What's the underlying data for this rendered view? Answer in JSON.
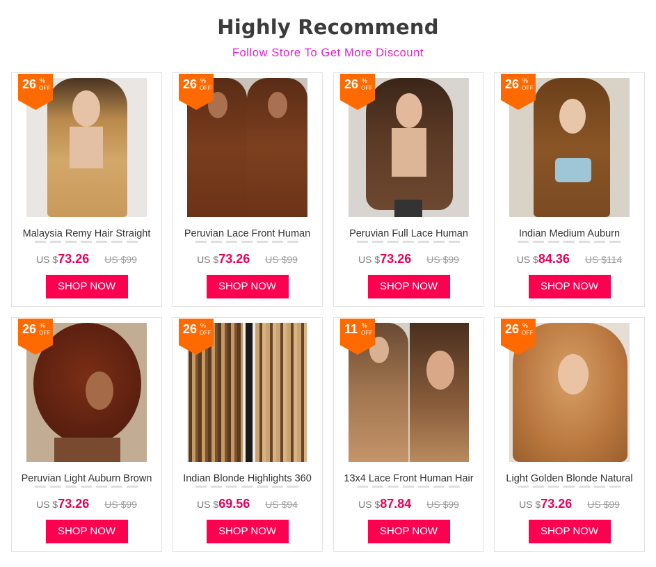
{
  "header": {
    "title": "Highly Recommend",
    "subtitle": "Follow Store To Get More Discount"
  },
  "colors": {
    "badge": "#ff6a00",
    "button": "#ff0051",
    "price": "#e8005a",
    "subtitle": "#e81fd0"
  },
  "badge_suffix": {
    "pct": "%",
    "off": "OFF"
  },
  "button_label": "SHOP NOW",
  "currency": "US $",
  "products": [
    {
      "name": "Malaysia Remy Hair Straight",
      "discount": "26",
      "price": "73.26",
      "old_price": "US $99",
      "image": "honey-blonde-straight-wig"
    },
    {
      "name": "Peruvian Lace Front Human",
      "discount": "26",
      "price": "73.26",
      "old_price": "US $99",
      "image": "brown-body-wave-wig-pair"
    },
    {
      "name": "Peruvian Full Lace Human",
      "discount": "26",
      "price": "73.26",
      "old_price": "US $99",
      "image": "brown-body-wave-wig-mannequin"
    },
    {
      "name": "Indian Medium Auburn",
      "discount": "26",
      "price": "84.36",
      "old_price": "US $114",
      "image": "auburn-straight-bangs-wig"
    },
    {
      "name": "Peruvian Light Auburn Brown",
      "discount": "26",
      "price": "73.26",
      "old_price": "US $99",
      "image": "auburn-curly-bob-wig"
    },
    {
      "name": "Indian Blonde Highlights 360",
      "discount": "26",
      "price": "69.56",
      "old_price": "US $94",
      "image": "blonde-highlight-straight-wig"
    },
    {
      "name": "13x4 Lace Front Human Hair",
      "discount": "11",
      "price": "87.84",
      "old_price": "US $99",
      "image": "caramel-wavy-wig"
    },
    {
      "name": "Light Golden Blonde Natural",
      "discount": "26",
      "price": "73.26",
      "old_price": "US $99",
      "image": "golden-blonde-wavy-wig"
    }
  ]
}
